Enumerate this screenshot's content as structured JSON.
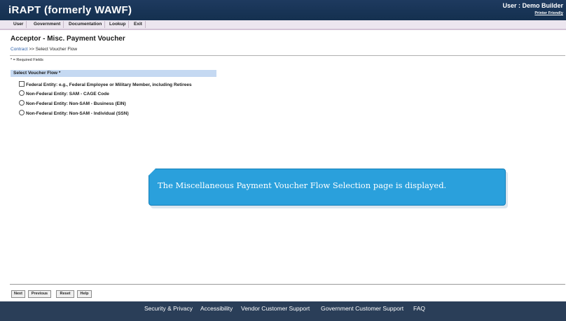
{
  "header": {
    "app_title": "iRAPT (formerly WAWF)",
    "user_label": "User : Demo Builder",
    "printer_friendly": "Printer Friendly"
  },
  "menu": {
    "items": [
      "User",
      "Government",
      "Documentation",
      "Lookup",
      "Exit"
    ]
  },
  "page": {
    "title": "Acceptor - Misc. Payment Voucher",
    "breadcrumb_link": "Contract",
    "breadcrumb_sep": ">>",
    "breadcrumb_current": "Select Voucher Flow",
    "required_note": "* = Required Fields"
  },
  "voucher_flow": {
    "section_label": "Select Voucher Flow *",
    "options": [
      {
        "label": "Federal Entity: e.g., Federal Employee or Military Member, including Retirees",
        "control": "checkbox"
      },
      {
        "label": "Non-Federal Entity: SAM - CAGE Code",
        "control": "radio"
      },
      {
        "label": "Non-Federal Entity: Non-SAM - Business (EIN)",
        "control": "radio"
      },
      {
        "label": "Non-Federal Entity: Non-SAM - Individual (SSN)",
        "control": "radio"
      }
    ]
  },
  "callout": {
    "text": "The Miscellaneous Payment Voucher Flow Selection page is displayed."
  },
  "buttons": {
    "next": "Next",
    "previous": "Previous",
    "reset": "Reset",
    "help": "Help"
  },
  "footer": {
    "links": [
      "Security & Privacy",
      "Accessibility",
      "Vendor Customer Support",
      "Government Customer Support",
      "FAQ"
    ]
  },
  "colors": {
    "header_bg": "#1e3a5f",
    "menubar_bg": "#ece6ef",
    "section_bar_bg": "#c5d9f2",
    "callout_bg": "#2aa0dc",
    "footer_bg": "#2a3e58",
    "link": "#2a5ea8"
  }
}
